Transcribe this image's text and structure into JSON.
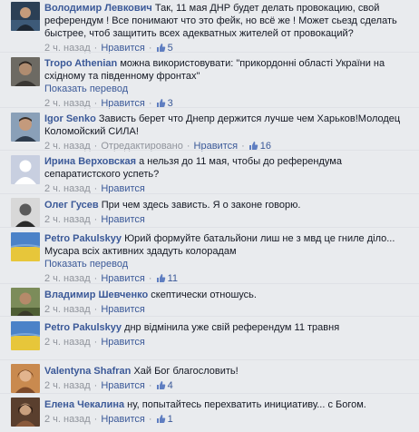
{
  "labels": {
    "like": "Нравится",
    "see_translation": "Показать перевод",
    "edited": "Отредактировано",
    "separator": "·"
  },
  "colors": {
    "link_blue": "#3b5998",
    "meta_gray": "#90949c",
    "background": "#e9ebee"
  },
  "comments": [
    {
      "author": "Володимир Левкович",
      "text": "Так, 11 мая ДНР будет делать провокацию, свой референдум ! Все понимают что это фейк, но всё же ! Может сьезд сделать быстрее, чтоб защитить всех адекватных жителей от провокаций?",
      "time": "2 ч. назад",
      "likes": "5",
      "avatar_icon": "profile-photo-dark-icon"
    },
    {
      "author": "Tropo Athenian",
      "text": "можна використовувати: \"прикордонні області України на східному та південному фронтах\"",
      "time": "2 ч. назад",
      "likes": "3",
      "translate": true,
      "avatar_icon": "profile-photo-man-icon"
    },
    {
      "author": "Igor Senko",
      "text": "Зависть берет что Днепр держится лучше чем Харьков!Молодец Коломойский СИЛА!",
      "time": "2 ч. назад",
      "likes": "16",
      "edited": true,
      "avatar_icon": "profile-photo-man-icon"
    },
    {
      "author": "Ирина Верховская",
      "text": "а нельзя до 11 мая, чтобы до референдума сепаратистского успеть?",
      "time": "2 ч. назад",
      "likes": "",
      "avatar_icon": "default-avatar-icon"
    },
    {
      "author": "Олег Гусев",
      "text": "При чем здесь зависть. Я о законе говорю.",
      "time": "2 ч. назад",
      "likes": "",
      "avatar_icon": "profile-photo-bw-icon"
    },
    {
      "author": "Petro Pakulskyy",
      "text": "Юрий формуйте батальйони лиш не з мвд це гниле діло... Мусара всіх активних здадуть колорадам",
      "time": "2 ч. назад",
      "likes": "11",
      "translate": true,
      "avatar_icon": "flag-field-avatar-icon"
    },
    {
      "author": "Владимир Шевченко",
      "text": "скептически отношусь.",
      "time": "2 ч. назад",
      "likes": "",
      "avatar_icon": "profile-photo-outdoor-icon"
    },
    {
      "author": "Petro Pakulskyy",
      "text": "днр відмінила уже свій референдум 11 травня",
      "time": "2 ч. назад",
      "likes": "",
      "avatar_icon": "flag-field-avatar-icon"
    },
    {
      "author": "Valentyna Shafran",
      "text": "Хай Бог благословить!",
      "time": "2 ч. назад",
      "likes": "4",
      "avatar_icon": "profile-photo-warm-icon"
    },
    {
      "author": "Елена Чекалина",
      "text": "ну, попытайтесь перехватить инициативу... с Богом.",
      "time": "2 ч. назад",
      "likes": "1",
      "avatar_icon": "profile-photo-brown-icon"
    }
  ]
}
